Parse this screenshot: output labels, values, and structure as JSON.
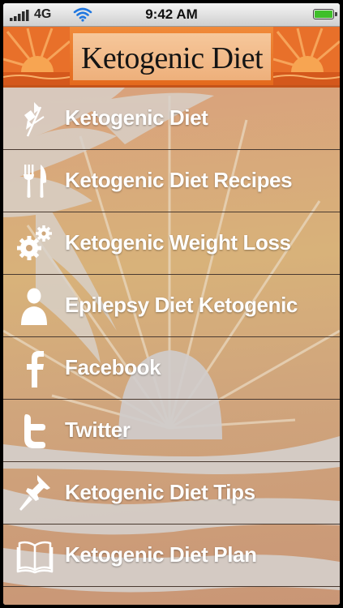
{
  "status_bar": {
    "carrier": "4G",
    "time": "9:42 AM",
    "signal_icon": "signal-bars-icon",
    "wifi_icon": "wifi-icon",
    "battery_icon": "battery-icon"
  },
  "header": {
    "title": "Ketogenic Diet",
    "accent_color": "#e8762a"
  },
  "menu": {
    "items": [
      {
        "label": "Ketogenic Diet",
        "icon": "wheat-icon"
      },
      {
        "label": "Ketogenic Diet Recipes",
        "icon": "fork-knife-icon"
      },
      {
        "label": "Ketogenic Weight Loss",
        "icon": "gears-icon"
      },
      {
        "label": "Epilepsy Diet Ketogenic",
        "icon": "person-icon"
      },
      {
        "label": "Facebook",
        "icon": "facebook-icon"
      },
      {
        "label": "Twitter",
        "icon": "twitter-icon"
      },
      {
        "label": "Ketogenic Diet Tips",
        "icon": "pushpin-icon"
      },
      {
        "label": "Ketogenic Diet Plan",
        "icon": "book-icon"
      }
    ]
  }
}
